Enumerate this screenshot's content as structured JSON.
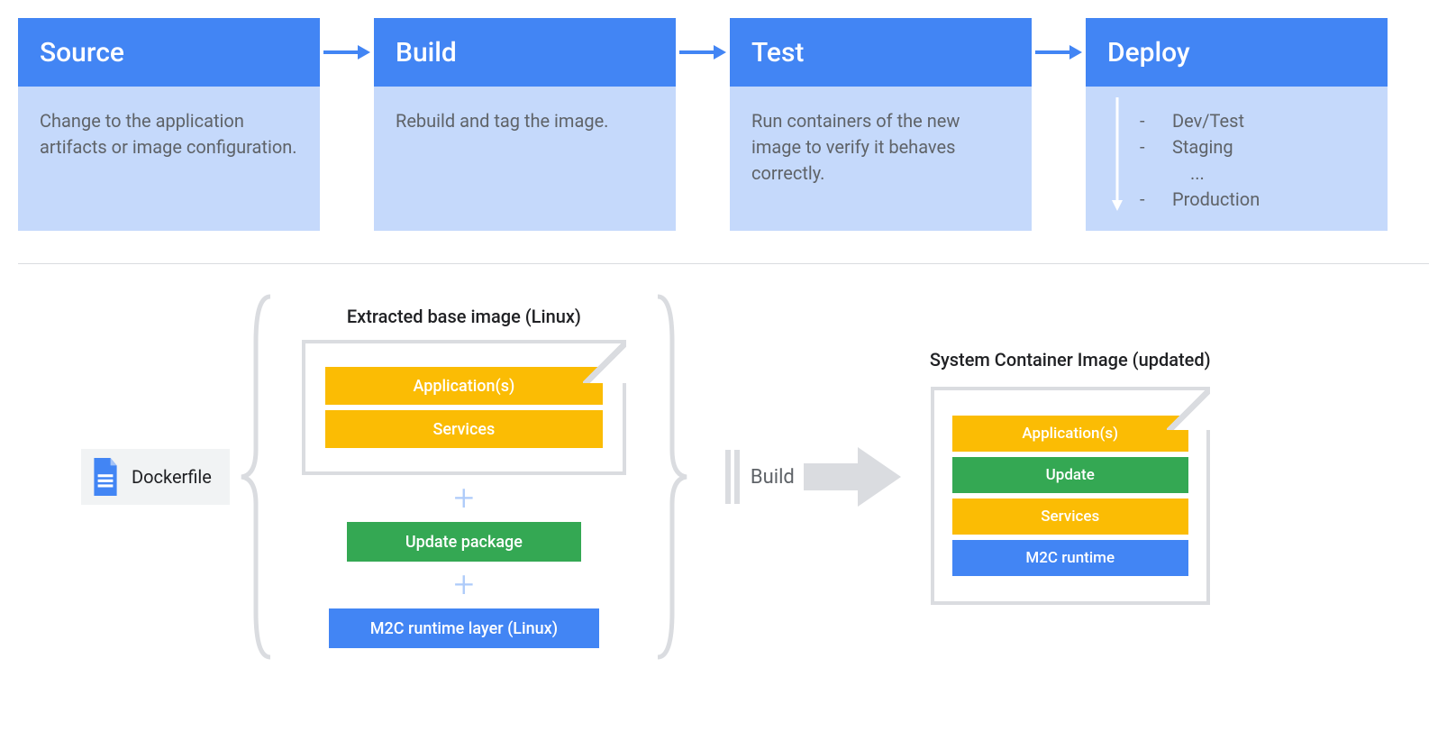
{
  "pipeline": {
    "stages": [
      {
        "title": "Source",
        "body": "Change to the application artifacts or image configuration."
      },
      {
        "title": "Build",
        "body": "Rebuild and tag the image."
      },
      {
        "title": "Test",
        "body": "Run containers of the new image to verify it behaves correctly."
      },
      {
        "title": "Deploy",
        "items": [
          "Dev/Test",
          "Staging",
          "Production"
        ],
        "ellipsis": "..."
      }
    ]
  },
  "lower": {
    "dockerfile_label": "Dockerfile",
    "extracted_title": "Extracted base image (Linux)",
    "layers_in_frame": [
      "Application(s)",
      "Services"
    ],
    "update_layer": "Update package",
    "m2c_layer": "M2C runtime layer (Linux)",
    "build_label": "Build",
    "result_title": "System Container Image (updated)",
    "result_layers": [
      {
        "text": "Application(s)",
        "color": "amber"
      },
      {
        "text": "Update",
        "color": "green"
      },
      {
        "text": "Services",
        "color": "amber"
      },
      {
        "text": "M2C runtime",
        "color": "blue"
      }
    ]
  },
  "glyphs": {
    "plus": "+",
    "dash": "-"
  }
}
